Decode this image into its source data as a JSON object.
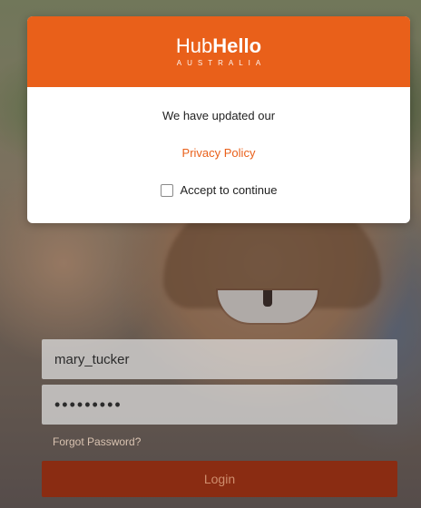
{
  "modal": {
    "brand_light": "Hub",
    "brand_bold": "Hello",
    "brand_sub": "AUSTRALIA",
    "message": "We have updated our",
    "policy_link": "Privacy Policy",
    "accept_label": "Accept to continue",
    "accent_color": "#e9601a"
  },
  "login": {
    "username_value": "mary_tucker",
    "password_value": "•••••••••",
    "forgot_label": "Forgot Password?",
    "login_label": "Login"
  }
}
